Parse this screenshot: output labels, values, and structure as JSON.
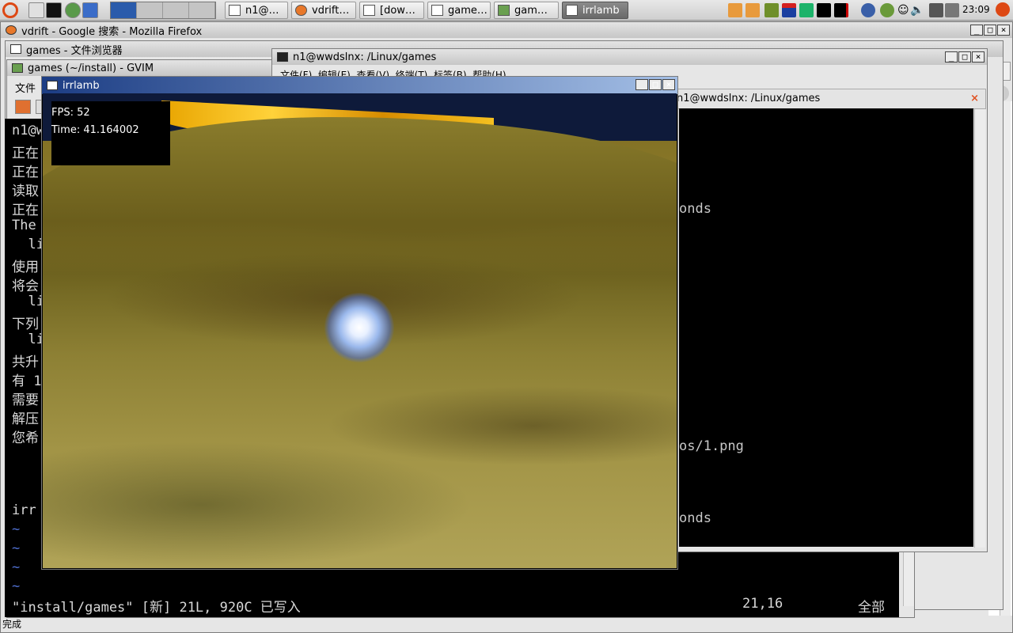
{
  "panel": {
    "tasks": [
      {
        "label": "n1@…"
      },
      {
        "label": "vdrift…"
      },
      {
        "label": "[dow…"
      },
      {
        "label": "game…"
      },
      {
        "label": "gam…"
      },
      {
        "label": "irrlamb"
      }
    ],
    "clock": "23:09"
  },
  "firefox": {
    "title": "vdrift - Google 搜索 - Mozilla Firefox",
    "status": "完成"
  },
  "file_browser": {
    "title": "games - 文件浏览器"
  },
  "gvim": {
    "title": "games (~/install) - GVIM",
    "menu_first": "文件",
    "lines": [
      "n1@w",
      "正在",
      "正在",
      "读取",
      "正在",
      "The",
      "  li",
      "使用",
      "将会",
      "  li",
      "下列",
      "  li",
      "共升",
      "有 1",
      "需要",
      "解压",
      "您希"
    ],
    "line_irr": "irr",
    "tilde": "~",
    "status": "\"install/games\" [新] 21L, 920C 已写入",
    "position": "21,16",
    "percent": "全部"
  },
  "terminal": {
    "title": "n1@wwdslnx: /Linux/games",
    "menu": "文件(F)  编辑(E)  查看(V)  终端(T)  标签(B)  帮助(H)",
    "tab_title": "n1@wwdslnx: /Linux/games",
    "lines": [
      {
        "text": "onds",
        "row": 5
      },
      {
        "text": "os/1.png",
        "row": 17
      },
      {
        "text": "onds",
        "row": 21
      }
    ]
  },
  "irrlamb": {
    "title": "irrlamb",
    "fps_label": "FPS: 52",
    "time_label": "Time: 41.164002"
  }
}
